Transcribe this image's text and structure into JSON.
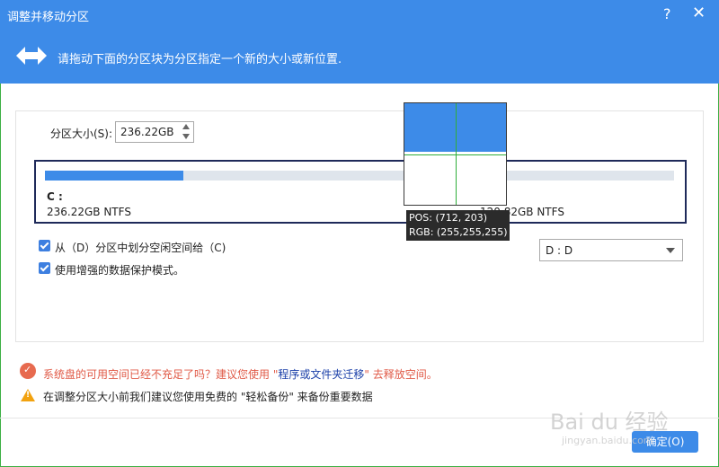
{
  "window": {
    "title": "调整并移动分区",
    "help": "?",
    "close": "✕"
  },
  "banner": {
    "text": "请拖动下面的分区块为分区指定一个新的大小或新位置."
  },
  "size": {
    "label": "分区大小(S):",
    "value": "236.22GB"
  },
  "disk": {
    "used_fraction": 0.22,
    "c_letter": "C :",
    "c_size": "236.22GB NTFS",
    "d_size": "120.82GB NTFS"
  },
  "options": {
    "opt1": "从（D）分区中划分空闲空间给（C)",
    "opt2": "使用增强的数据保护模式。",
    "select_value": "D : D"
  },
  "hints": {
    "hint1_pre": "系统盘的可用空间已经不充足了吗？建议您使用 \"",
    "hint1_link": "程序或文件夹迁移",
    "hint1_post": "\" 去释放空间。",
    "hint2": "在调整分区大小前我们建议您使用免费的 \"轻松备份\" 来备份重要数据"
  },
  "buttons": {
    "ok": "确定(O)"
  },
  "overlay": {
    "pos": "POS: (712, 203)",
    "rgb": "RGB: (255,255,255)"
  },
  "watermark": {
    "main": "Bai du 经验",
    "sub": "jingyan.baidu.com"
  },
  "colors": {
    "accent": "#3d8be8",
    "warning": "#e05a47"
  }
}
